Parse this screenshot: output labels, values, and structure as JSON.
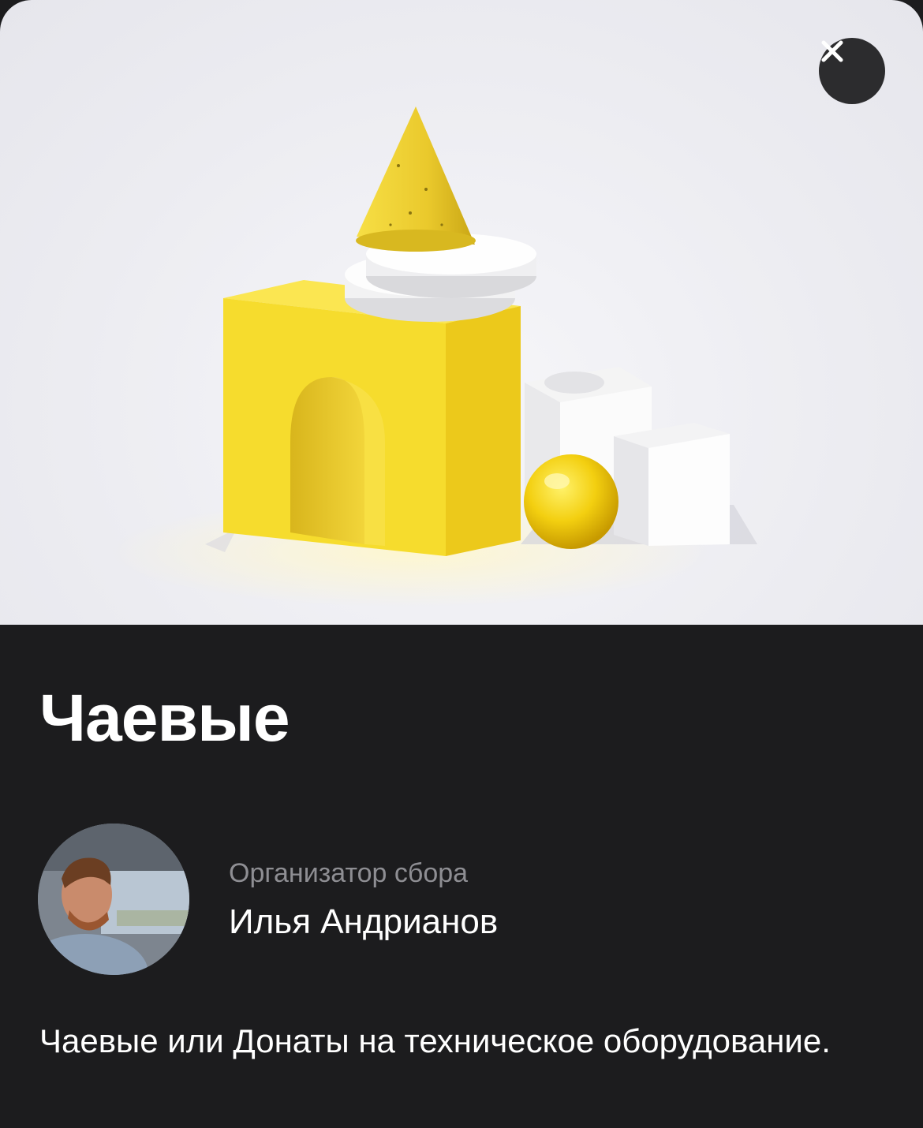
{
  "header": {
    "close_icon": "close-icon"
  },
  "hero": {
    "illustration": "yellow-white-geometric-shapes"
  },
  "title": "Чаевые",
  "organizer": {
    "label": "Организатор сбора",
    "name": "Илья Андрианов",
    "avatar_icon": "avatar"
  },
  "description": "Чаевые или Донаты на техническое оборудование.",
  "colors": {
    "background": "#1c1c1e",
    "accent_yellow": "#f8df3c",
    "secondary_text": "#8e8e93"
  }
}
